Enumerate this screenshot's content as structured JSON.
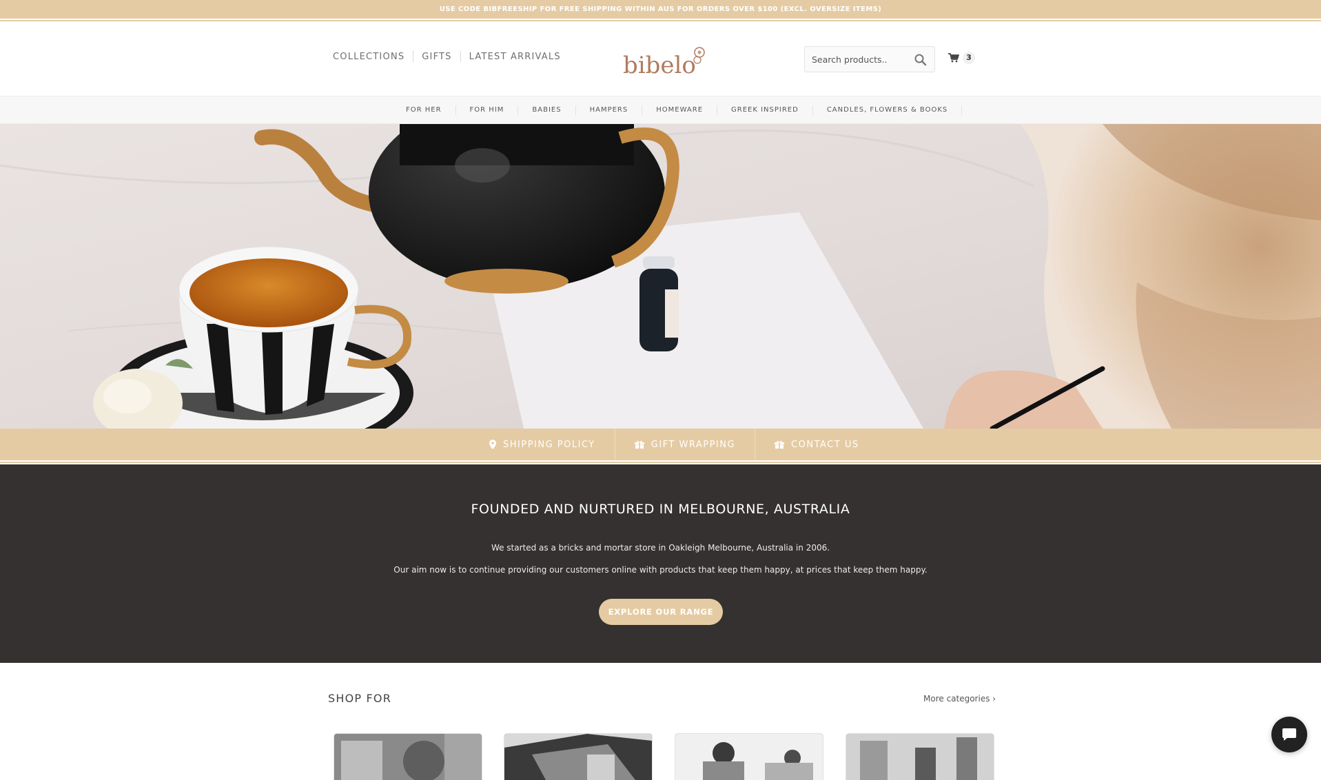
{
  "promo": {
    "text": "USE CODE BIBFREESHIP FOR FREE SHIPPING WITHIN AUS FOR ORDERS OVER $100 (EXCL. OVERSIZE ITEMS)"
  },
  "header": {
    "nav": [
      "COLLECTIONS",
      "GIFTS",
      "LATEST ARRIVALS"
    ],
    "logo_text": "bibelo",
    "search_placeholder": "Search products..",
    "cart_count": "3"
  },
  "categories": [
    "FOR HER",
    "FOR HIM",
    "BABIES",
    "HAMPERS",
    "HOMEWARE",
    "GREEK INSPIRED",
    "CANDLES, FLOWERS & BOOKS"
  ],
  "infobar": {
    "shipping": "SHIPPING POLICY",
    "gift": "GIFT WRAPPING",
    "contact": "CONTACT US"
  },
  "about": {
    "title": "FOUNDED AND NURTURED IN MELBOURNE, AUSTRALIA",
    "line1": "We started as a bricks and mortar store in Oakleigh Melbourne, Australia in 2006.",
    "line2": "Our aim now is to continue providing our customers online with products that keep them happy, at prices that keep them happy.",
    "button": "EXPLORE OUR RANGE"
  },
  "shop": {
    "title": "SHOP FOR",
    "more": "More categories ›"
  },
  "colors": {
    "accent": "#e5cba3",
    "dark": "#343130",
    "logo": "#b07b5e"
  }
}
